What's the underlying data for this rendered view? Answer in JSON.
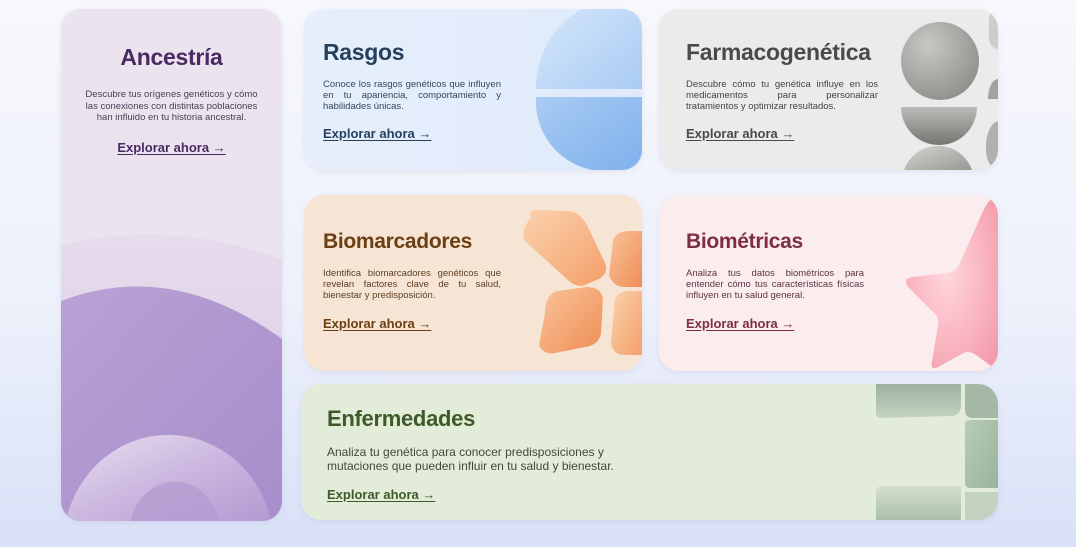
{
  "cards": {
    "ancestria": {
      "title": "Ancestría",
      "description": "Descubre tus orígenes genéticos y cómo las conexiones con distintas poblaciones han influido en tu historia ancestral.",
      "cta": "Explorar ahora →"
    },
    "rasgos": {
      "title": "Rasgos",
      "description": "Conoce los rasgos genéticos que influyen en tu apariencia, comportamiento y habilidades únicas.",
      "cta": "Explorar ahora →"
    },
    "farmacogenetica": {
      "title": "Farmacogenética",
      "description": "Descubre cómo tu genética influye en los medicamentos para personalizar tratamientos y optimizar resultados.",
      "cta": "Explorar ahora →"
    },
    "biomarcadores": {
      "title": "Biomarcadores",
      "description": "Identifica biomarcadores genéticos que revelan factores clave de tu salud, bienestar y predisposición.",
      "cta": "Explorar ahora →"
    },
    "biometricas": {
      "title": "Biométricas",
      "description": "Analiza tus datos biométricos para entender cómo tus características físicas influyen en tu salud general.",
      "cta": "Explorar ahora →"
    },
    "enfermedades": {
      "title": "Enfermedades",
      "description": "Analiza tu genética para conocer predisposiciones y mutaciones que pueden influir en tu salud y bienestar.",
      "cta": "Explorar ahora →"
    }
  },
  "colors": {
    "ancestria_accent": "#4a2a62",
    "rasgos_accent": "#26415e",
    "farmaco_accent": "#4a4a4a",
    "biomarcadores_accent": "#6b3f12",
    "biometricas_accent": "#7d2d44",
    "enfermedades_accent": "#3f5a2a"
  },
  "icons": {
    "ancestria": "concentric-arcs-shape",
    "rasgos": "split-circle-shape",
    "farmacogenetica": "grey-circles-shape",
    "biomarcadores": "orange-petals-shape",
    "biometricas": "pink-star-shape",
    "enfermedades": "green-blocks-shape"
  }
}
